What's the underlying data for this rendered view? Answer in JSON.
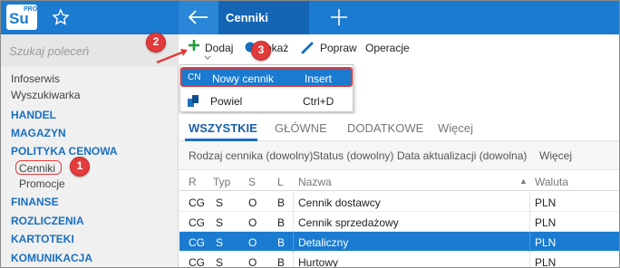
{
  "app": {
    "logo_text": "Su",
    "logo_badge": "PRO",
    "active_tab": "Cenniki"
  },
  "sidebar": {
    "search_placeholder": "Szukaj poleceń",
    "items": [
      {
        "label": "Infoserwis",
        "type": "item"
      },
      {
        "label": "Wyszukiwarka",
        "type": "item"
      },
      {
        "label": "HANDEL",
        "type": "category"
      },
      {
        "label": "MAGAZYN",
        "type": "category"
      },
      {
        "label": "POLITYKA CENOWA",
        "type": "category"
      },
      {
        "label": "Cenniki",
        "type": "sub"
      },
      {
        "label": "Promocje",
        "type": "sub"
      },
      {
        "label": "FINANSE",
        "type": "category"
      },
      {
        "label": "ROZLICZENIA",
        "type": "category"
      },
      {
        "label": "KARTOTEKI",
        "type": "category"
      },
      {
        "label": "KOMUNIKACJA",
        "type": "category"
      }
    ]
  },
  "toolbar": {
    "add": "Dodaj",
    "show": "Pokaż",
    "fix": "Popraw",
    "operations": "Operacje"
  },
  "menu": {
    "items": [
      {
        "icon": "CN",
        "label": "Nowy cennik",
        "shortcut": "Insert"
      },
      {
        "icon": "",
        "label": "Powiel",
        "shortcut": "Ctrl+D"
      }
    ]
  },
  "tabs": [
    "WSZYSTKIE",
    "GŁÓWNE",
    "DODATKOWE",
    "Więcej"
  ],
  "filters": [
    "Rodzaj cennika (dowolny)",
    "Status (dowolny)",
    "Data aktualizacji (dowolna)",
    "Więcej"
  ],
  "table": {
    "columns": [
      "R",
      "Typ",
      "S",
      "L",
      "Nazwa",
      "Waluta"
    ],
    "sort_indicator": "▲",
    "rows": [
      [
        "CG",
        "S",
        "O",
        "B",
        "Cennik dostawcy",
        "PLN"
      ],
      [
        "CG",
        "S",
        "O",
        "B",
        "Cennik sprzedażowy",
        "PLN"
      ],
      [
        "CG",
        "S",
        "O",
        "B",
        "Detaliczny",
        "PLN"
      ],
      [
        "CG",
        "S",
        "O",
        "B",
        "Hurtowy",
        "PLN"
      ]
    ],
    "selected_row": 2
  },
  "callouts": [
    "1",
    "2",
    "3"
  ],
  "colors": {
    "accent": "#1a7bd0",
    "callout": "#e23b3b"
  }
}
